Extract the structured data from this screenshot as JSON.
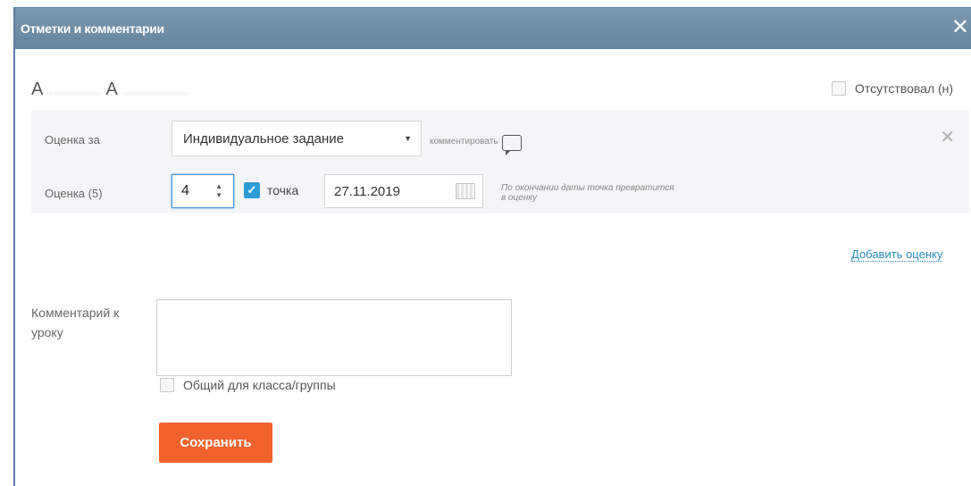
{
  "dialog": {
    "title": "Отметки и комментарии",
    "close_glyph": "✕"
  },
  "student": {
    "initial1": "А",
    "blurred1": "...........",
    "initial2": "А",
    "blurred2": ".............."
  },
  "absent": {
    "label": "Отсутствовал (н)",
    "checked": false
  },
  "grade_row1": {
    "label": "Оценка за",
    "selected_option": "Индивидуальное задание",
    "comment_link": "комментировать"
  },
  "grade_row2": {
    "label": "Оценка (5)",
    "value": "4",
    "point_label": "точка",
    "point_checked": true,
    "date": "27.11.2019",
    "hint": "По окончании даты точка превратится в оценку"
  },
  "add_grade": "Добавить оценку",
  "lesson_comment": {
    "label": "Комментарий к уроку",
    "value": "",
    "common_label": "Общий для класса/группы",
    "common_checked": false
  },
  "save_button": "Сохранить",
  "icons": {
    "close": "close-icon",
    "dropdown": "chevron-down-icon",
    "comment": "speech-bubble-icon",
    "calendar": "calendar-icon",
    "check": "checkmark-icon"
  },
  "colors": {
    "titlebar": "#6f8ea7",
    "accent_blue": "#2e9bd6",
    "save_orange": "#f2622d",
    "link": "#2a8bb8"
  }
}
